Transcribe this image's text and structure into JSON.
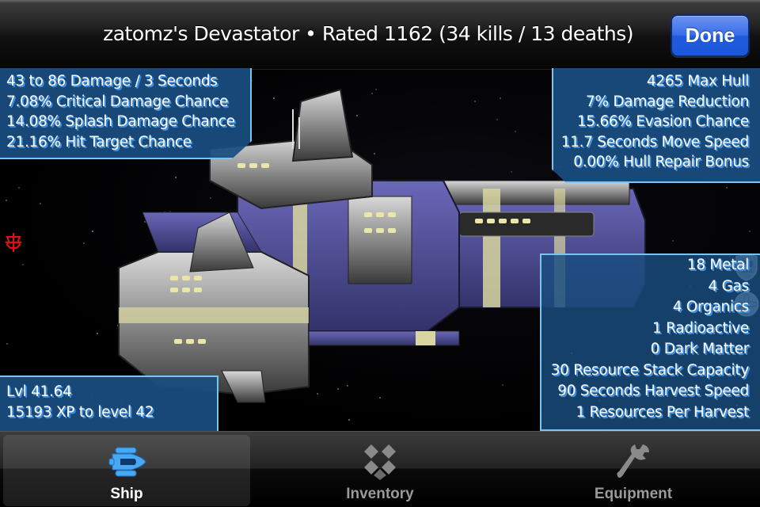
{
  "header": {
    "title": "zatomz's Devastator • Rated 1162 (34 kills / 13 deaths)",
    "done_label": "Done"
  },
  "panels": {
    "weapons": [
      "43 to 86 Damage / 3 Seconds",
      "7.08% Critical Damage Chance",
      "14.08% Splash Damage Chance",
      "21.16% Hit Target Chance"
    ],
    "defense": [
      "4265 Max Hull",
      "7% Damage Reduction",
      "15.66% Evasion Chance",
      "11.7 Seconds Move Speed",
      "0.00% Hull Repair Bonus"
    ],
    "resources": [
      "18 Metal",
      "4 Gas",
      "4 Organics",
      "1 Radioactive",
      "0 Dark Matter",
      "30 Resource Stack Capacity",
      "90 Seconds Harvest Speed",
      "1 Resources Per Harvest"
    ],
    "level": [
      "Lvl 41.64",
      "15193 XP to level 42"
    ]
  },
  "icons": {
    "left_side": "faction-emblem-icon",
    "right_side": [
      "shield-badge-icon",
      "medal-icon"
    ]
  },
  "tabs": [
    {
      "label": "Ship",
      "icon": "ship-icon",
      "active": true
    },
    {
      "label": "Inventory",
      "icon": "boxes-icon",
      "active": false
    },
    {
      "label": "Equipment",
      "icon": "wrench-icon",
      "active": false
    }
  ],
  "colors": {
    "panel_bg": "#1a4e80",
    "panel_border": "#7cc4f0",
    "text_shadow": "#3f8ee0",
    "done_button": "#2a62e4",
    "active_tab_icon": "#4aa8f0",
    "alert_red": "#e01010"
  }
}
